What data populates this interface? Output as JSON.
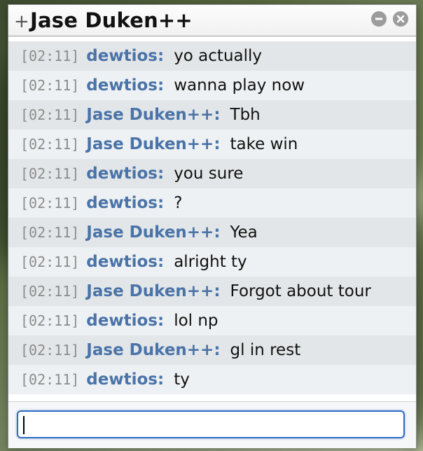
{
  "window": {
    "title_prefix": "+",
    "title": "Jase Duken++"
  },
  "controls": {
    "minimize_icon": "minimize-icon",
    "close_icon": "close-icon"
  },
  "messages": [
    {
      "time": "[02:11]",
      "user": "dewtios:",
      "text": "yo actually"
    },
    {
      "time": "[02:11]",
      "user": "dewtios:",
      "text": "wanna play now"
    },
    {
      "time": "[02:11]",
      "user": "Jase Duken++:",
      "text": "Tbh"
    },
    {
      "time": "[02:11]",
      "user": "Jase Duken++:",
      "text": "take win"
    },
    {
      "time": "[02:11]",
      "user": "dewtios:",
      "text": "you sure"
    },
    {
      "time": "[02:11]",
      "user": "dewtios:",
      "text": "?"
    },
    {
      "time": "[02:11]",
      "user": "Jase Duken++:",
      "text": "Yea"
    },
    {
      "time": "[02:11]",
      "user": "dewtios:",
      "text": "alright ty"
    },
    {
      "time": "[02:11]",
      "user": "Jase Duken++:",
      "text": "Forgot about tour"
    },
    {
      "time": "[02:11]",
      "user": "dewtios:",
      "text": "lol np"
    },
    {
      "time": "[02:11]",
      "user": "Jase Duken++:",
      "text": "gl in rest"
    },
    {
      "time": "[02:11]",
      "user": "dewtios:",
      "text": "ty"
    }
  ],
  "input": {
    "value": "",
    "placeholder": ""
  },
  "colors": {
    "username": "#4a73a8",
    "timestamp": "#8c8c8c",
    "row_alt": "#e3e6e8",
    "row_norm": "#eef1f3",
    "input_border": "#2f6bc4"
  }
}
